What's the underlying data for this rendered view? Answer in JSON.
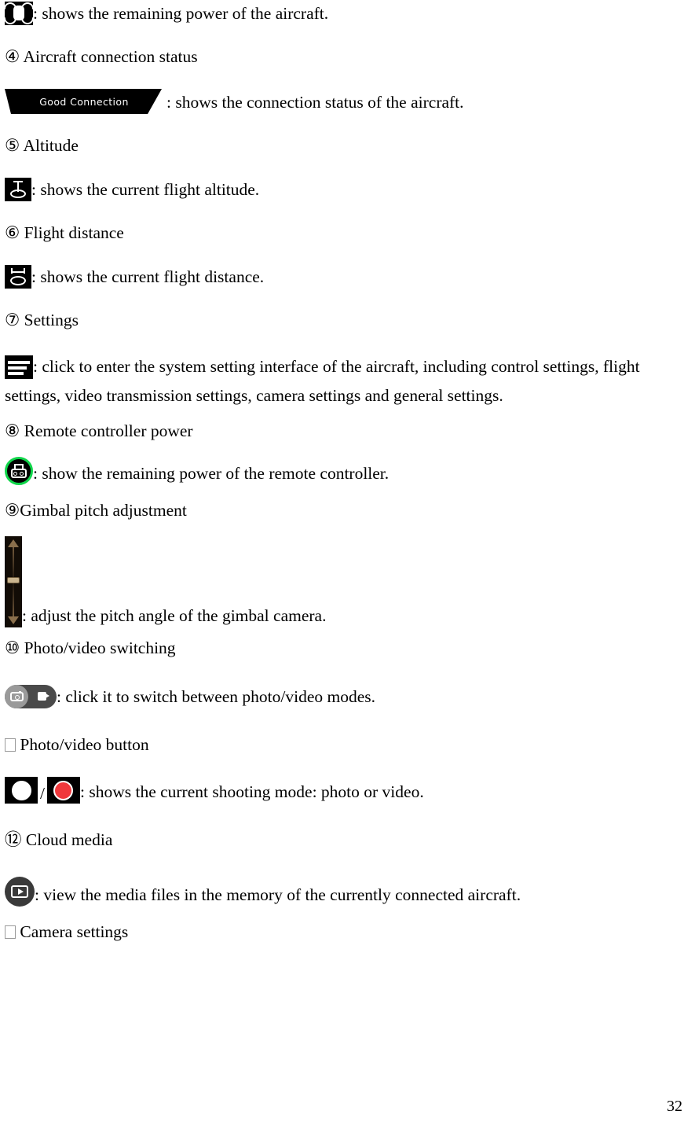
{
  "document": {
    "page_number": "32",
    "colors": {
      "icon_background": "#000000",
      "connection_status_background": "#000000",
      "remote_controller_ring": "#10d54a",
      "record_button": "#f0383c",
      "switch_track": "#4a4a4a",
      "switch_knob": "#9a9a9a",
      "media_button": "#3a3a3a",
      "text": "#000000",
      "page_background": "#ffffff"
    }
  },
  "entries": [
    {
      "id": "aircraft-power",
      "icon_name": "aircraft-battery-icon",
      "description": ": shows the remaining power of the aircraft."
    },
    {
      "id": "aircraft-connection-status",
      "number": "④",
      "heading": "Aircraft connection status",
      "icon_name": "good-connection-banner",
      "icon_label": "Good Connection",
      "description": ": shows the connection status of the aircraft."
    },
    {
      "id": "altitude",
      "number": "⑤",
      "heading": "Altitude",
      "icon_name": "altitude-icon",
      "description": ": shows the current flight altitude."
    },
    {
      "id": "flight-distance",
      "number": "⑥",
      "heading": "Flight distance",
      "icon_name": "flight-distance-icon",
      "description": ": shows the current flight distance."
    },
    {
      "id": "settings",
      "number": "⑦",
      "heading": "Settings",
      "icon_name": "settings-menu-icon",
      "description": ": click to enter the system setting interface of the aircraft, including control settings, flight settings, video transmission settings, camera settings and general settings."
    },
    {
      "id": "remote-controller-power",
      "number": "⑧",
      "heading": "Remote controller power",
      "icon_name": "remote-controller-icon",
      "description": ": show the remaining power of the remote controller."
    },
    {
      "id": "gimbal-pitch-adjustment",
      "number": "⑨",
      "heading": "Gimbal pitch adjustment",
      "icon_name": "gimbal-pitch-slider",
      "description": ": adjust the pitch angle of the gimbal camera."
    },
    {
      "id": "photo-video-switching",
      "number": "⑩",
      "heading": "Photo/video switching",
      "icon_name": "photo-video-toggle",
      "description": ": click it to switch between photo/video modes."
    },
    {
      "id": "photo-video-button",
      "number": "□",
      "heading": "Photo/video button",
      "icon_name": "shutter-buttons",
      "separator": "/",
      "description": ": shows the current shooting mode: photo or video."
    },
    {
      "id": "cloud-media",
      "number": "⑫",
      "heading": "Cloud media",
      "icon_name": "cloud-media-icon",
      "description": ": view the media files in the memory of the currently connected aircraft."
    },
    {
      "id": "camera-settings",
      "number": "□",
      "heading": "Camera settings"
    }
  ]
}
